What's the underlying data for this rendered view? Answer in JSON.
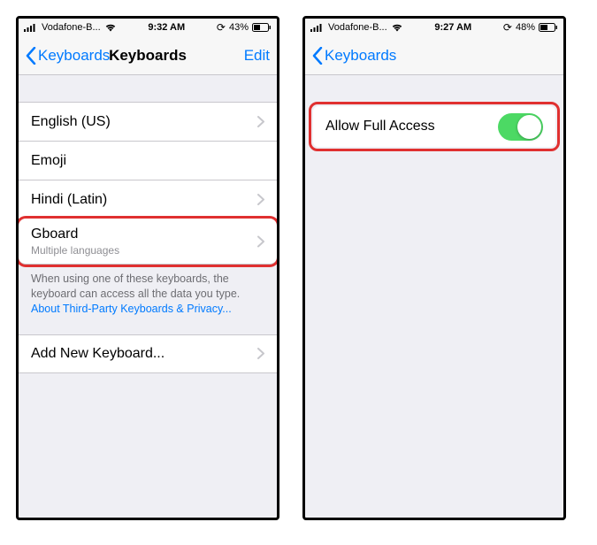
{
  "left": {
    "status": {
      "carrier": "Vodafone-B...",
      "time": "9:32 AM",
      "battery": "43%"
    },
    "nav": {
      "back": "Keyboards",
      "title": "Keyboards",
      "edit": "Edit"
    },
    "rows": {
      "english": "English (US)",
      "emoji": "Emoji",
      "hindi": "Hindi (Latin)",
      "gboard_title": "Gboard",
      "gboard_sub": "Multiple languages",
      "add": "Add New Keyboard..."
    },
    "footer": {
      "text": "When using one of these keyboards, the keyboard can access all the data you type. ",
      "link": "About Third-Party Keyboards & Privacy..."
    }
  },
  "right": {
    "status": {
      "carrier": "Vodafone-B...",
      "time": "9:27 AM",
      "battery": "48%"
    },
    "nav": {
      "back": "Keyboards"
    },
    "toggle": {
      "label": "Allow Full Access",
      "on": true
    }
  }
}
